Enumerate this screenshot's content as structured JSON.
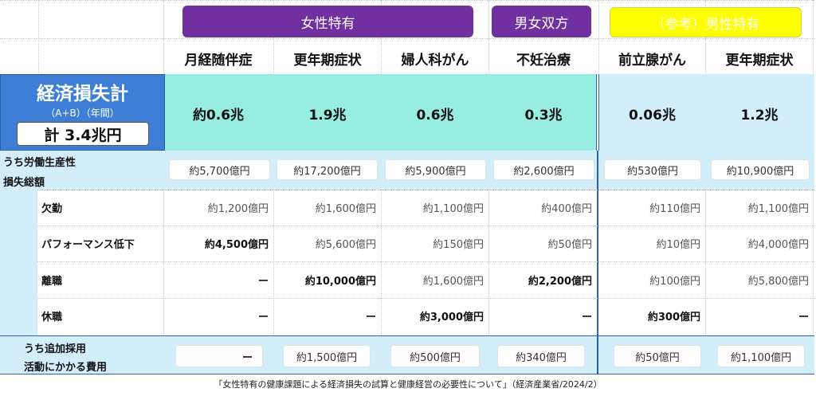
{
  "groups": {
    "female": "女性特有",
    "both": "男女双方",
    "male": "（参考）男性特有"
  },
  "columns": [
    "月経随伴症",
    "更年期症状",
    "婦人科がん",
    "不妊治療",
    "前立腺がん",
    "更年期症状"
  ],
  "economic_loss": {
    "title": "経済損失計",
    "subtitle": "（A+B）（年間）",
    "total": "計 3.4兆円",
    "values": [
      "約0.6兆",
      "1.9兆",
      "0.6兆",
      "0.3兆",
      "0.06兆",
      "1.2兆"
    ]
  },
  "productivity": {
    "label_line1": "うち労働生産性",
    "label_line2": "損失総額",
    "values": [
      "約5,700億円",
      "約17,200億円",
      "約5,900億円",
      "約2,600億円",
      "約530億円",
      "約10,900億円"
    ]
  },
  "rows": [
    {
      "label": "欠勤",
      "values": [
        "約1,200億円",
        "約1,600億円",
        "約1,100億円",
        "約400億円",
        "約110億円",
        "約1,100億円"
      ]
    },
    {
      "label": "パフォーマンス低下",
      "values": [
        "約4,500億円",
        "約5,600億円",
        "約150億円",
        "約50億円",
        "約10億円",
        "約4,000億円"
      ]
    },
    {
      "label": "離職",
      "values": [
        "ー",
        "約10,000億円",
        "約1,600億円",
        "約2,200億円",
        "約100億円",
        "約5,800億円"
      ]
    },
    {
      "label": "休職",
      "values": [
        "ー",
        "ー",
        "約3,000億円",
        "ー",
        "約300億円",
        "ー"
      ]
    }
  ],
  "hiring": {
    "label_line1": "うち追加採用",
    "label_line2": "活動にかかる費用",
    "values": [
      "ー",
      "約1,500億円",
      "約500億円",
      "約340億円",
      "約50億円",
      "約1,100億円"
    ]
  },
  "footer": "「女性特有の健康課題による経済損失の試算と健康経営の必要性について」（経済産業省/2024/2）",
  "colors": {
    "purple": "#7030a0",
    "yellow": "#ffff00",
    "blue": "#3d7fd6",
    "teal": "#96ede0",
    "lightblue": "#d3eefb"
  }
}
